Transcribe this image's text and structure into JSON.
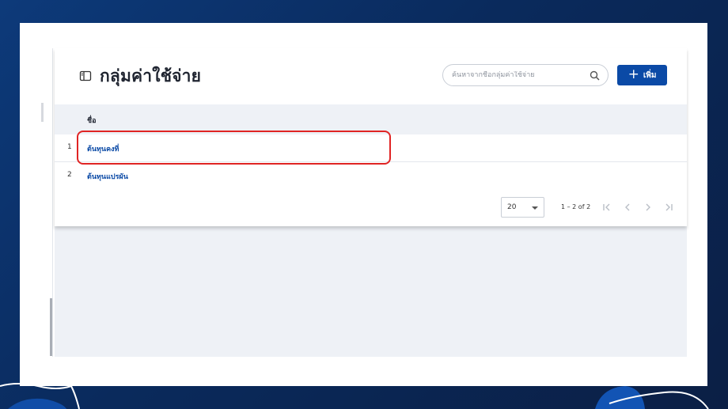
{
  "page": {
    "title": "กลุ่มค่าใช้จ่าย",
    "title_icon": "sidebar-panel-icon"
  },
  "search": {
    "placeholder": "ค้นหาจากชื่อกลุ่มค่าใช้จ่าย",
    "value": "",
    "icon": "search-icon"
  },
  "toolbar": {
    "add_label": "เพิ่ม",
    "add_icon": "plus-icon"
  },
  "table": {
    "columns": [
      "ชื่อ"
    ],
    "rows": [
      {
        "index": "1",
        "name": "ต้นทุนคงที่"
      },
      {
        "index": "2",
        "name": "ต้นทุนแปรผัน"
      }
    ]
  },
  "pagination": {
    "page_size": "20",
    "range_label": "1 – 2 of 2"
  },
  "colors": {
    "primary": "#0b4aa6",
    "highlight": "#e02424",
    "background_gradient_start": "#0d3a7a",
    "background_gradient_end": "#0b1f45"
  }
}
